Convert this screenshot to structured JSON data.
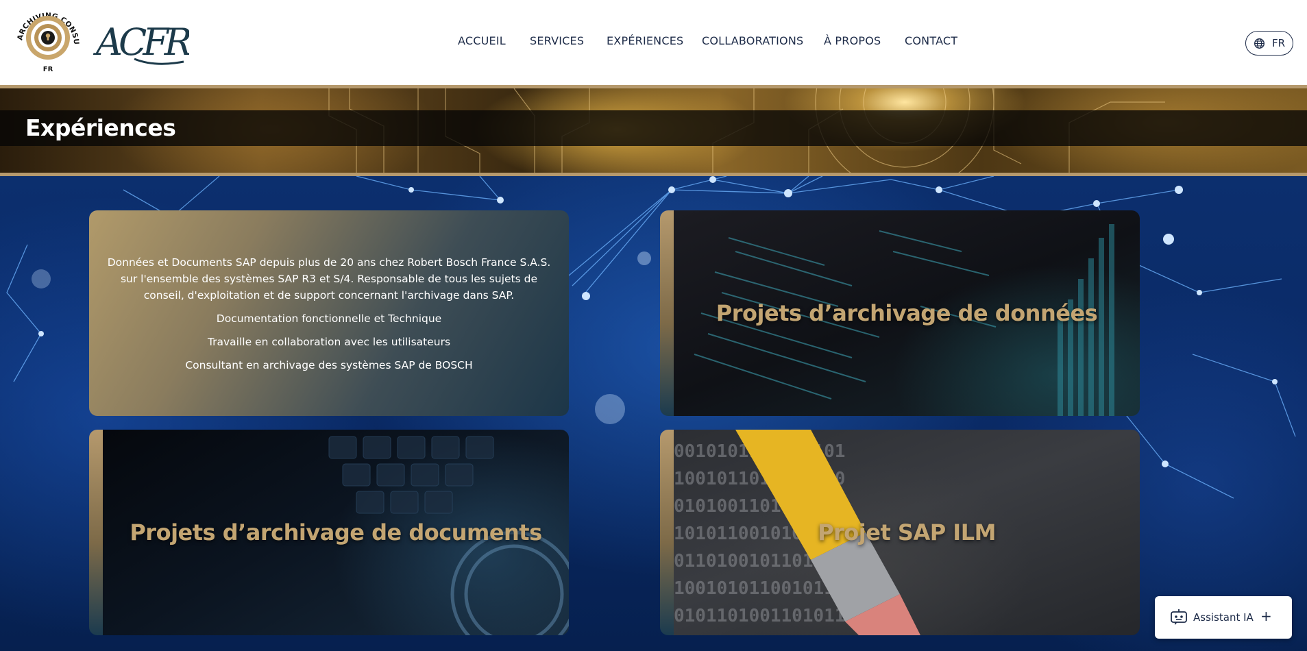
{
  "brand": {
    "emblem_text_top": "ARCHIVING CONSULTING",
    "emblem_text_bottom": "FR",
    "wordmark": "ACFR"
  },
  "nav": {
    "items": [
      {
        "label": "ACCUEIL"
      },
      {
        "label": "SERVICES"
      },
      {
        "label": "EXPÉRIENCES"
      },
      {
        "label": "COLLABORATIONS"
      },
      {
        "label": "À PROPOS"
      },
      {
        "label": "CONTACT"
      }
    ],
    "language": "FR",
    "language_icon": "globe-icon"
  },
  "page": {
    "title": "Expériences"
  },
  "intro_card": {
    "paragraph": "Données et Documents SAP depuis plus de 20 ans chez Robert Bosch France S.A.S. sur l'ensemble des systèmes SAP R3 et S/4. Responsable de tous les sujets de conseil, d'exploitation et de support concernant l'archivage dans SAP.",
    "lines": [
      "Documentation fonctionnelle et Technique",
      "Travaille en collaboration avec les utilisateurs",
      "Consultant en archivage des systèmes SAP de BOSCH"
    ]
  },
  "cards": [
    {
      "heading": "Projets d’archivage de données"
    },
    {
      "heading": "Projets d’archivage de documents"
    },
    {
      "heading": "Projet SAP ILM"
    }
  ],
  "assistant": {
    "label": "Assistant IA",
    "plus": "+",
    "icon": "robot-chat-icon"
  },
  "colors": {
    "gold": "#b5996d",
    "heading_gold": "#c3a572",
    "navy": "#1d2b48",
    "deep_blue": "#0b2a63"
  }
}
